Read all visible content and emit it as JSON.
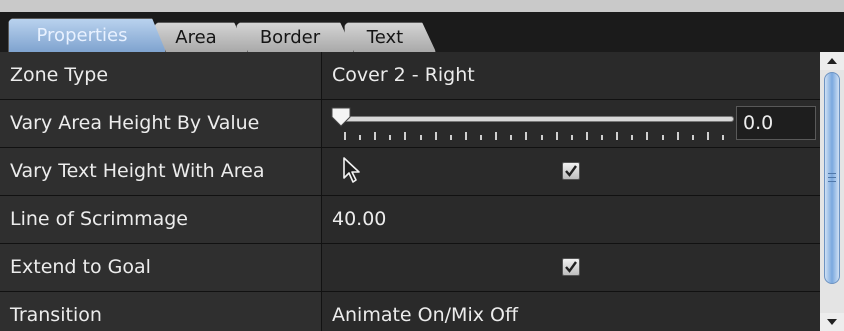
{
  "tabs": [
    {
      "label": "Properties",
      "active": true
    },
    {
      "label": "Area",
      "active": false
    },
    {
      "label": "Border",
      "active": false
    },
    {
      "label": "Text",
      "active": false
    }
  ],
  "properties": {
    "zone_type": {
      "label": "Zone Type",
      "value": "Cover 2 - Right"
    },
    "vary_area_height": {
      "label": "Vary Area Height By Value",
      "slider_fraction": 0.0,
      "value": "0.0"
    },
    "vary_text_height": {
      "label": "Vary Text Height With Area",
      "checked": true
    },
    "line_of_scrimmage": {
      "label": "Line of Scrimmage",
      "value": "40.00"
    },
    "extend_to_goal": {
      "label": "Extend to Goal",
      "checked": true
    },
    "transition": {
      "label": "Transition",
      "value": "Animate On/Mix Off"
    }
  },
  "colors": {
    "active_tab": "#9bbbe0",
    "scroll_thumb": "#7aa8de"
  }
}
